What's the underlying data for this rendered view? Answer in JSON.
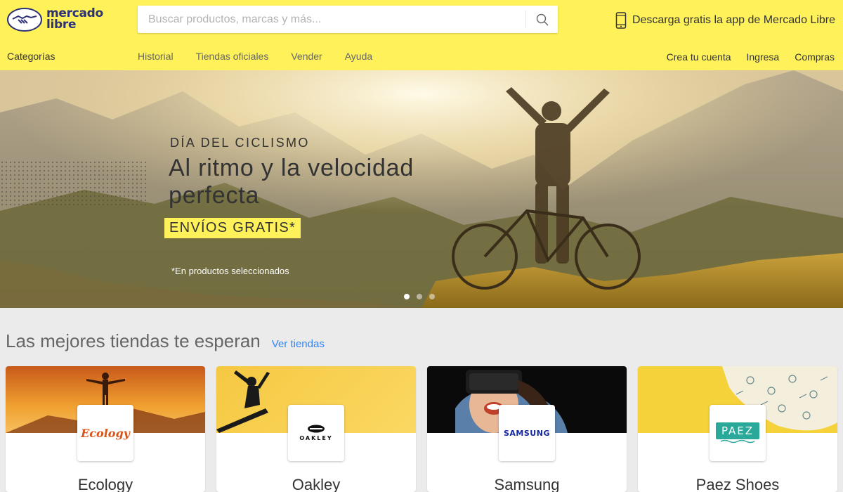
{
  "header": {
    "logo_text_line1": "mercado",
    "logo_text_line2": "libre",
    "search_placeholder": "Buscar productos, marcas y más...",
    "app_promo": "Descarga gratis la app de Mercado Libre"
  },
  "nav": {
    "categories": "Categorías",
    "links": [
      "Historial",
      "Tiendas oficiales",
      "Vender",
      "Ayuda"
    ],
    "account": [
      "Crea tu cuenta",
      "Ingresa",
      "Compras"
    ]
  },
  "hero": {
    "kicker": "DÍA DEL CICLISMO",
    "title": "Al ritmo y la velocidad perfecta",
    "badge": "ENVÍOS GRATIS*",
    "note": "*En productos seleccionados",
    "slide_count": 3,
    "active_slide": 1
  },
  "stores": {
    "title": "Las mejores tiendas te esperan",
    "link": "Ver tiendas",
    "items": [
      {
        "name": "Ecology",
        "logo_text": "Ecology"
      },
      {
        "name": "Oakley",
        "logo_text": "OAKLEY"
      },
      {
        "name": "Samsung",
        "logo_text": "SAMSUNG"
      },
      {
        "name": "Paez Shoes",
        "logo_text": "PAEZ"
      }
    ]
  },
  "colors": {
    "brand_yellow": "#fff159",
    "brand_blue": "#2d3277",
    "link_blue": "#3483fa"
  }
}
